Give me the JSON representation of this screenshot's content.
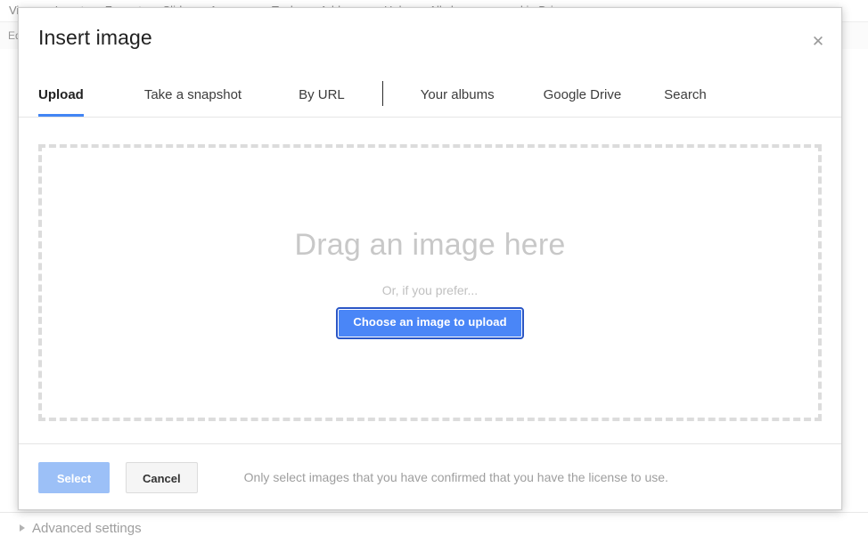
{
  "background": {
    "menubar_items": [
      "View",
      "Insert",
      "Format",
      "Slide",
      "Arrange",
      "Tools",
      "Add-ons",
      "Help",
      "All changes saved in Drive"
    ],
    "toolbar_items": [
      "Edit",
      "|",
      "",
      "",
      "",
      "",
      "",
      "",
      "",
      ""
    ],
    "advanced_settings": {
      "label": "Advanced settings",
      "disclosure_icon": "triangle-right-icon"
    }
  },
  "dialog": {
    "title": "Insert image",
    "close_icon": "close-icon",
    "close_glyph": "✕",
    "tabs": [
      {
        "label": "Upload",
        "active": true
      },
      {
        "label": "Take a snapshot",
        "active": false
      },
      {
        "label": "By URL",
        "active": false
      },
      {
        "label": "Your albums",
        "active": false
      },
      {
        "label": "Google Drive",
        "active": false
      },
      {
        "label": "Search",
        "active": false
      }
    ],
    "dropzone": {
      "headline": "Drag an image here",
      "subtext": "Or, if you prefer...",
      "choose_button_label": "Choose an image to upload"
    },
    "footer": {
      "select_label": "Select",
      "cancel_label": "Cancel",
      "license_note": "Only select images that you have confirmed that you have the license to use."
    }
  },
  "colors": {
    "accent_blue": "#4285f4",
    "button_blue": "#4a86f7",
    "focus_ring_blue": "#2a56c6",
    "disabled_blue": "#9cc0f7",
    "dashed_border": "#dcdcdc",
    "placeholder_gray": "#c8c8c8",
    "text_dark": "#212121",
    "muted_gray": "#9e9e9e"
  }
}
